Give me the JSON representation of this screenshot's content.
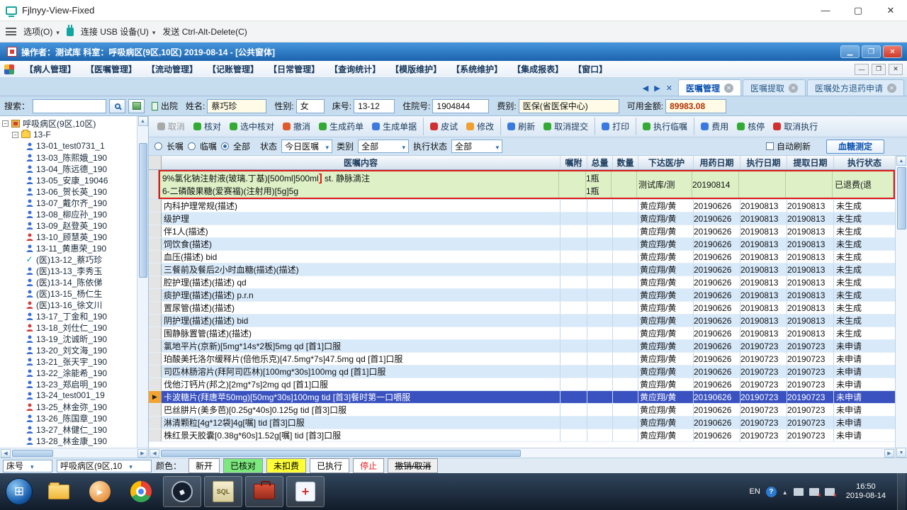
{
  "window": {
    "title": "Fjlnyy-View-Fixed",
    "menu": {
      "options": "选项(O)",
      "usb": "连接 USB 设备(U)",
      "cad": "发送 Ctrl-Alt-Delete(C)"
    }
  },
  "app": {
    "header": "操作者：测试库  科室：呼吸病区(9区,10区)  2019-08-14 - [公共窗体]",
    "menus": [
      "【病人管理】",
      "【医嘱管理】",
      "【流动管理】",
      "【记账管理】",
      "【日常管理】",
      "【查询统计】",
      "【模版维护】",
      "【系统维护】",
      "【集成报表】",
      "【窗口】"
    ],
    "tabs": [
      {
        "label": "医嘱管理",
        "cls": "active"
      },
      {
        "label": "医嘱提取"
      },
      {
        "label": "医嘱处方退药申请"
      }
    ]
  },
  "search": {
    "label": "搜索：",
    "discharge": "出院"
  },
  "patient": {
    "name_label": "姓名:",
    "name": "蔡巧珍",
    "gender_label": "性别:",
    "gender": "女",
    "bed_label": "床号:",
    "bed": "13-12",
    "adm_label": "住院号:",
    "adm": "1904844",
    "fee_label": "费别:",
    "fee": "医保(省医保中心)",
    "amt_label": "可用金额:",
    "amt": "89983.08"
  },
  "tree": {
    "root": "呼吸病区(9区,10区)",
    "floor": "13-F",
    "patients": [
      {
        "name": "13-01_test0731_1",
        "icon": "blue"
      },
      {
        "name": "13-03_陈熙娥_190",
        "icon": "blue"
      },
      {
        "name": "13-04_陈远德_190",
        "icon": "blue"
      },
      {
        "name": "13-05_安康_19046",
        "icon": "blue"
      },
      {
        "name": "13-06_贺长英_190",
        "icon": "blue"
      },
      {
        "name": "13-07_戴尔齐_190",
        "icon": "blue"
      },
      {
        "name": "13-08_柳应孙_190",
        "icon": "blue"
      },
      {
        "name": "13-09_赵登英_190",
        "icon": "blue"
      },
      {
        "name": "13-10_顾慧英_190",
        "icon": "red"
      },
      {
        "name": "13-11_黄惠荣_190",
        "icon": "blue"
      },
      {
        "name": "(医)13-12_蔡巧珍",
        "icon": "check"
      },
      {
        "name": "(医)13-13_李秀玉",
        "icon": "blue"
      },
      {
        "name": "(医)13-14_陈依俤",
        "icon": "blue"
      },
      {
        "name": "(医)13-15_杨仁生",
        "icon": "blue"
      },
      {
        "name": "(医)13-16_徐文川",
        "icon": "red"
      },
      {
        "name": "13-17_丁金和_190",
        "icon": "blue"
      },
      {
        "name": "13-18_刘仕仁_190",
        "icon": "red"
      },
      {
        "name": "13-19_沈诚昕_190",
        "icon": "blue"
      },
      {
        "name": "13-20_刘文海_190",
        "icon": "blue"
      },
      {
        "name": "13-21_张天宇_190",
        "icon": "blue"
      },
      {
        "name": "13-22_涂能希_190",
        "icon": "blue"
      },
      {
        "name": "13-23_郑启明_190",
        "icon": "blue"
      },
      {
        "name": "13-24_test001_19",
        "icon": "blue"
      },
      {
        "name": "13-25_林金弥_190",
        "icon": "red"
      },
      {
        "name": "13-26_陈国章_190",
        "icon": "blue"
      },
      {
        "name": "13-27_林健仁_190",
        "icon": "blue"
      },
      {
        "name": "13-28_林金康_190",
        "icon": "blue"
      }
    ]
  },
  "toolbar": {
    "buttons": [
      {
        "label": "取消",
        "color": "#a8a8a8",
        "cls": "dim"
      },
      {
        "label": "核对",
        "color": "#33aa33"
      },
      {
        "label": "选中核对",
        "color": "#33aa33"
      },
      {
        "label": "撤消",
        "color": "#e05a2a"
      },
      {
        "label": "生成药单",
        "color": "#33aa33"
      },
      {
        "label": "生成单据",
        "color": "#3a7ae0"
      },
      {
        "label": "皮试",
        "color": "#d03030",
        "cls": "sep"
      },
      {
        "label": "修改",
        "color": "#f0a030"
      },
      {
        "label": "刷新",
        "color": "#3a7ae0",
        "cls": "sep"
      },
      {
        "label": "取消提交",
        "color": "#33aa33"
      },
      {
        "label": "打印",
        "color": "#3a7ae0",
        "cls": "sep"
      },
      {
        "label": "执行临嘱",
        "color": "#33aa33",
        "cls": "sep"
      },
      {
        "label": "费用",
        "color": "#3a7ae0",
        "cls": "sep"
      },
      {
        "label": "核停",
        "color": "#33aa33"
      },
      {
        "label": "取消执行",
        "color": "#d03030"
      }
    ]
  },
  "filters": {
    "r1": "长嘱",
    "r2": "临嘱",
    "r3": "全部",
    "status_label": "状态",
    "status_value": "今日医嘱",
    "type_label": "类别",
    "type_value": "全部",
    "exec_label": "执行状态",
    "exec_value": "全部",
    "auto": "自动刷新",
    "glucose": "血糖测定"
  },
  "table": {
    "columns": [
      "医嘱内容",
      "嘱附",
      "总量",
      "数量",
      "下达医/护",
      "用药日期",
      "执行日期",
      "提取日期",
      "执行状态"
    ],
    "group": {
      "line1_pre": "9%氯化钠注射液(玻璃.丁基)[500ml]500ml",
      "cursor_mark": "]",
      "line1_post": " st. 静脉滴注",
      "line2": "6-二磷酸果糖(爱赛福)(注射用)[5g]5g",
      "qty1": "1瓶",
      "qty2": "1瓶",
      "doctor": "测试库/测",
      "date1": "20190814",
      "status": "已退费(退"
    },
    "rows": [
      {
        "content": "内科护理常规(描述)",
        "doctor": "黄应翔/黄",
        "date1": "20190626",
        "date2": "20190813",
        "date3": "20190813",
        "status": "未生成"
      },
      {
        "content": "级护理",
        "doctor": "黄应翔/黄",
        "date1": "20190626",
        "date2": "20190813",
        "date3": "20190813",
        "status": "未生成"
      },
      {
        "content": "伴1人(描述)",
        "doctor": "黄应翔/黄",
        "date1": "20190626",
        "date2": "20190813",
        "date3": "20190813",
        "status": "未生成"
      },
      {
        "content": "饲饮食(描述)",
        "doctor": "黄应翔/黄",
        "date1": "20190626",
        "date2": "20190813",
        "date3": "20190813",
        "status": "未生成"
      },
      {
        "content": "血压(描述) bid",
        "doctor": "黄应翔/黄",
        "date1": "20190626",
        "date2": "20190813",
        "date3": "20190813",
        "status": "未生成"
      },
      {
        "content": "三餐前及餐后2小时血糖(描述)(描述)",
        "doctor": "黄应翔/黄",
        "date1": "20190626",
        "date2": "20190813",
        "date3": "20190813",
        "status": "未生成"
      },
      {
        "content": "腔护理(描述)(描述) qd",
        "doctor": "黄应翔/黄",
        "date1": "20190626",
        "date2": "20190813",
        "date3": "20190813",
        "status": "未生成"
      },
      {
        "content": "痰护理(描述)(描述) p.r.n",
        "doctor": "黄应翔/黄",
        "date1": "20190626",
        "date2": "20190813",
        "date3": "20190813",
        "status": "未生成"
      },
      {
        "content": "置尿管(描述)(描述)",
        "doctor": "黄应翔/黄",
        "date1": "20190626",
        "date2": "20190813",
        "date3": "20190813",
        "status": "未生成"
      },
      {
        "content": "阴护理(描述)(描述) bid",
        "doctor": "黄应翔/黄",
        "date1": "20190626",
        "date2": "20190813",
        "date3": "20190813",
        "status": "未生成"
      },
      {
        "content": "围静脉置管(描述)(描述)",
        "doctor": "黄应翔/黄",
        "date1": "20190626",
        "date2": "20190813",
        "date3": "20190813",
        "status": "未生成"
      },
      {
        "content": "氯地平片(京新)[5mg*14s*2板]5mg qd [首1]口服",
        "doctor": "黄应翔/黄",
        "date1": "20190626",
        "date2": "20190723",
        "date3": "20190723",
        "status": "未申请"
      },
      {
        "content": "珀酸美托洛尔缓释片(倍他乐克)[47.5mg*7s]47.5mg qd [首1]口服",
        "doctor": "黄应翔/黄",
        "date1": "20190626",
        "date2": "20190723",
        "date3": "20190723",
        "status": "未申请"
      },
      {
        "content": "司匹林肠溶片(拜阿司匹林)[100mg*30s]100mg qd [首1]口服",
        "doctor": "黄应翔/黄",
        "date1": "20190626",
        "date2": "20190723",
        "date3": "20190723",
        "status": "未申请"
      },
      {
        "content": "伐他汀钙片(邦之)[2mg*7s]2mg qd [首1]口服",
        "doctor": "黄应翔/黄",
        "date1": "20190626",
        "date2": "20190723",
        "date3": "20190723",
        "status": "未申请"
      },
      {
        "content": "卡波糖片(拜唐苹50mg)[50mg*30s]100mg tid [首3]餐时第一口嚼服",
        "doctor": "黄应翔/黄",
        "date1": "20190626",
        "date2": "20190723",
        "date3": "20190723",
        "status": "未申请",
        "cls": "selected"
      },
      {
        "content": "巴丝肼片(美多芭)[0.25g*40s]0.125g tid [首3]口服",
        "doctor": "黄应翔/黄",
        "date1": "20190626",
        "date2": "20190723",
        "date3": "20190723",
        "status": "未申请"
      },
      {
        "content": "淋清颗粒[4g*12袋]4g[嘱] tid [首3]口服",
        "doctor": "黄应翔/黄",
        "date1": "20190626",
        "date2": "20190723",
        "date3": "20190723",
        "status": "未申请"
      },
      {
        "content": "株红景天胶囊[0.38g*60s]1.52g[嘱] tid [首3]口服",
        "doctor": "黄应翔/黄",
        "date1": "20190626",
        "date2": "20190723",
        "date3": "20190723",
        "status": "未申请"
      }
    ]
  },
  "bottom": {
    "bed_label": "床号",
    "ward": "呼吸病区(9区,10",
    "color_label": "颜色：",
    "legend": [
      {
        "label": "新开",
        "bg": "#ffffff",
        "fg": "#000000"
      },
      {
        "label": "已核对",
        "bg": "#7de87d",
        "fg": "#000000"
      },
      {
        "label": "未扣费",
        "bg": "#ffff38",
        "fg": "#000000"
      },
      {
        "label": "已执行",
        "bg": "#ffffff",
        "fg": "#000000"
      },
      {
        "label": "停止",
        "bg": "#ffffff",
        "fg": "#e02020"
      },
      {
        "label": "撤销/取消",
        "bg": "#efefef",
        "fg": "#000000",
        "cls": "strike"
      }
    ]
  },
  "taskbar": {
    "sql": "SQL",
    "lang": "EN",
    "help": "?",
    "time": "16:50",
    "date": "2019-08-14"
  }
}
